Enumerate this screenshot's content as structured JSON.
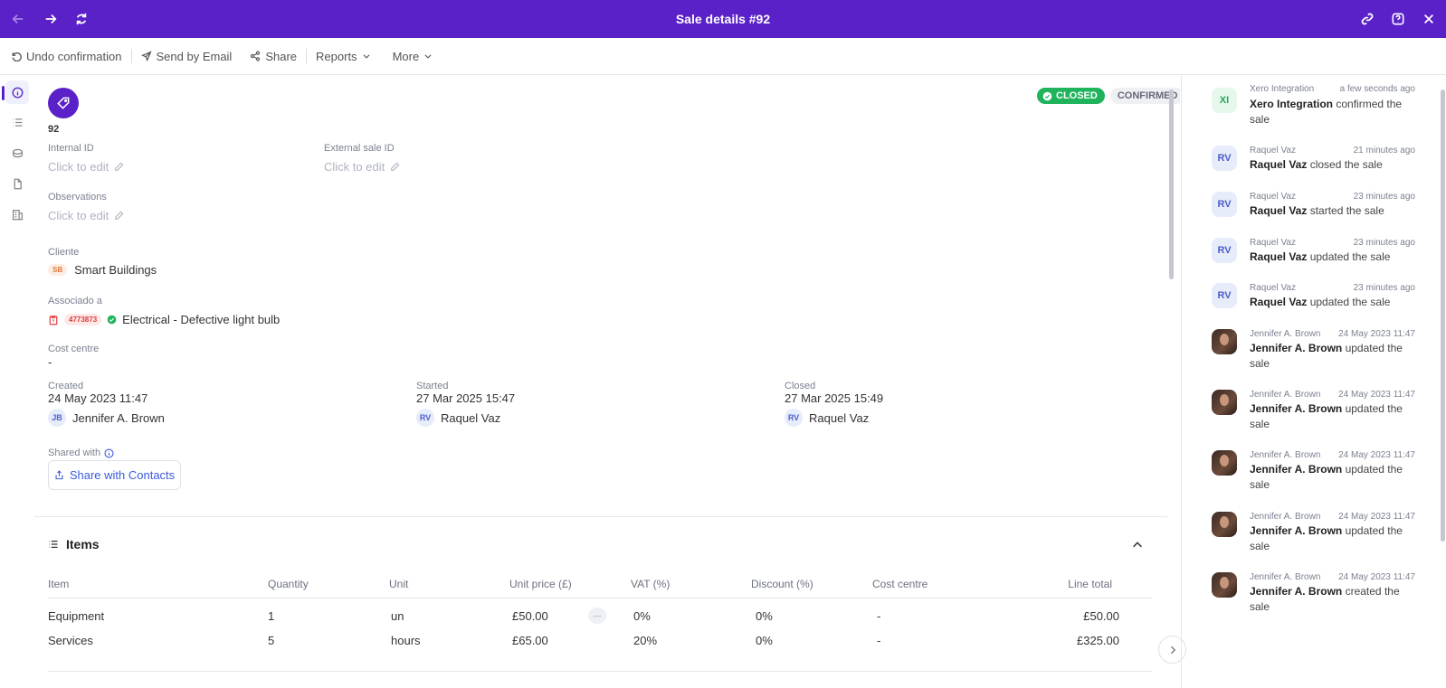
{
  "window": {
    "title": "Sale details #92"
  },
  "toolbar": {
    "undo_label": "Undo confirmation",
    "email_label": "Send by Email",
    "share_label": "Share",
    "reports_label": "Reports",
    "more_label": "More"
  },
  "header": {
    "sale_number": "92",
    "status_closed": "CLOSED",
    "status_confirmed": "CONFIRMED"
  },
  "fields": {
    "internal_id_label": "Internal ID",
    "external_id_label": "External sale ID",
    "observations_label": "Observations",
    "click_to_edit": "Click to edit",
    "client_label": "Cliente",
    "client_initials": "SB",
    "client_name": "Smart Buildings",
    "associated_label": "Associado a",
    "associated_ref": "4773873",
    "associated_name": "Electrical - Defective light bulb",
    "cost_centre_label": "Cost centre",
    "cost_centre_value": "-",
    "created_label": "Created",
    "created_date": "24 May 2023 11:47",
    "created_initials": "JB",
    "created_by": "Jennifer A. Brown",
    "started_label": "Started",
    "started_date": "27 Mar 2025 15:47",
    "started_initials": "RV",
    "started_by": "Raquel Vaz",
    "closed_label": "Closed",
    "closed_date": "27 Mar 2025 15:49",
    "closed_initials": "RV",
    "closed_by": "Raquel Vaz",
    "shared_with_label": "Shared with",
    "share_contacts_label": "Share with Contacts"
  },
  "items": {
    "title": "Items",
    "columns": [
      "Item",
      "Quantity",
      "Unit",
      "Unit price (£)",
      "VAT (%)",
      "Discount (%)",
      "Cost centre",
      "Line total"
    ],
    "more_glyph": "···",
    "rows": [
      {
        "item": "Equipment",
        "quantity": "1",
        "unit": "un",
        "unit_price": "£50.00",
        "vat": "0%",
        "discount": "0%",
        "cost_centre": "-",
        "line_total": "£50.00"
      },
      {
        "item": "Services",
        "quantity": "5",
        "unit": "hours",
        "unit_price": "£65.00",
        "vat": "20%",
        "discount": "0%",
        "cost_centre": "-",
        "line_total": "£325.00"
      }
    ]
  },
  "activity": [
    {
      "initials": "XI",
      "who": "Xero Integration",
      "time": "a few seconds ago",
      "actor": "Xero Integration",
      "action": "confirmed the sale"
    },
    {
      "initials": "RV",
      "who": "Raquel Vaz",
      "time": "21 minutes ago",
      "actor": "Raquel Vaz",
      "action": "closed the sale"
    },
    {
      "initials": "RV",
      "who": "Raquel Vaz",
      "time": "23 minutes ago",
      "actor": "Raquel Vaz",
      "action": "started the sale"
    },
    {
      "initials": "RV",
      "who": "Raquel Vaz",
      "time": "23 minutes ago",
      "actor": "Raquel Vaz",
      "action": "updated the sale"
    },
    {
      "initials": "RV",
      "who": "Raquel Vaz",
      "time": "23 minutes ago",
      "actor": "Raquel Vaz",
      "action": "updated the sale"
    },
    {
      "initials": "",
      "who": "Jennifer A. Brown",
      "time": "24 May 2023 11:47",
      "actor": "Jennifer A. Brown",
      "action": "updated the sale"
    },
    {
      "initials": "",
      "who": "Jennifer A. Brown",
      "time": "24 May 2023 11:47",
      "actor": "Jennifer A. Brown",
      "action": "updated the sale"
    },
    {
      "initials": "",
      "who": "Jennifer A. Brown",
      "time": "24 May 2023 11:47",
      "actor": "Jennifer A. Brown",
      "action": "updated the sale"
    },
    {
      "initials": "",
      "who": "Jennifer A. Brown",
      "time": "24 May 2023 11:47",
      "actor": "Jennifer A. Brown",
      "action": "updated the sale"
    },
    {
      "initials": "",
      "who": "Jennifer A. Brown",
      "time": "24 May 2023 11:47",
      "actor": "Jennifer A. Brown",
      "action": "created the sale"
    }
  ],
  "colors": {
    "brand": "#5b21c9",
    "closed": "#1fb35b",
    "link": "#3b5bdb"
  }
}
